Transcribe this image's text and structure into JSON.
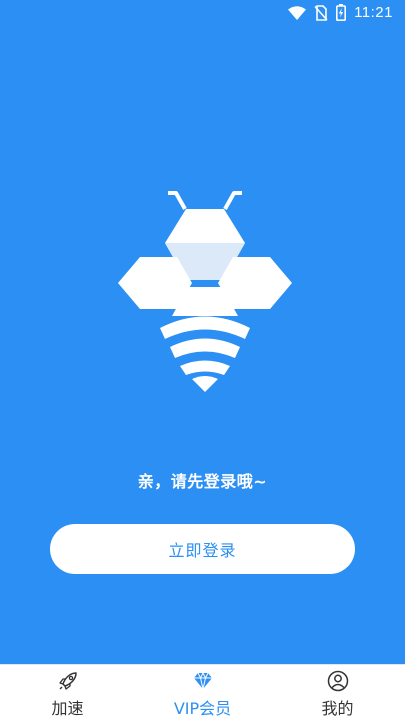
{
  "status_bar": {
    "time": "11:21",
    "icons": [
      "wifi-icon",
      "no-sim-icon",
      "battery-charging-icon"
    ]
  },
  "logo": {
    "icon": "bee-wifi-logo"
  },
  "main": {
    "prompt": "亲，请先登录哦~",
    "login_button_label": "立即登录"
  },
  "bottom_nav": {
    "items": [
      {
        "label": "加速",
        "icon": "rocket-icon",
        "active": false
      },
      {
        "label": "VIP会员",
        "icon": "diamond-icon",
        "active": true
      },
      {
        "label": "我的",
        "icon": "user-icon",
        "active": false
      }
    ]
  },
  "colors": {
    "background": "#2b8ff3",
    "accent": "#2b8ff3",
    "surface": "#ffffff",
    "text_dark": "#333333"
  }
}
